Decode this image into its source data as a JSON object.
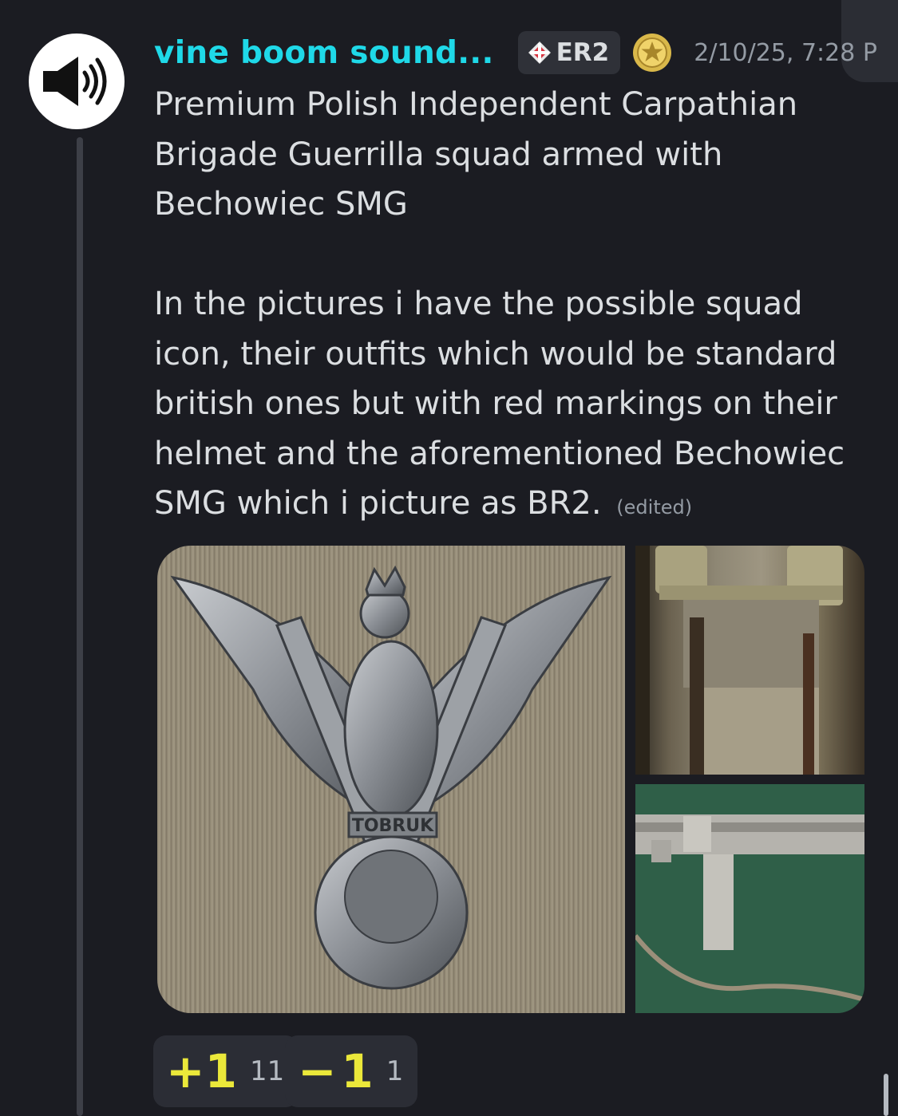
{
  "message": {
    "author": "vine boom sound...",
    "tag": "ER2",
    "timestamp": "2/10/25, 7:28 P",
    "paragraph1": "Premium Polish Independent Carpathian Brigade Guerrilla squad armed with Bechowiec SMG",
    "paragraph2": "In the pictures i have the possible squad icon, their outfits which would be standard british ones but with red markings on their helmet and the aforementioned Bechowiec SMG which i picture as BR2.",
    "edited": "(edited)",
    "attachments": [
      {
        "name": "eagle-badge",
        "inscription": "TOBRUK"
      },
      {
        "name": "uniform"
      },
      {
        "name": "smg"
      }
    ]
  },
  "reactions": [
    {
      "emoji": "+1",
      "count": "11"
    },
    {
      "emoji": "− 1",
      "count": "1"
    }
  ],
  "colors": {
    "username": "#1fd9e8",
    "background": "#1b1c22",
    "reaction_emoji": "#ebe83a"
  }
}
